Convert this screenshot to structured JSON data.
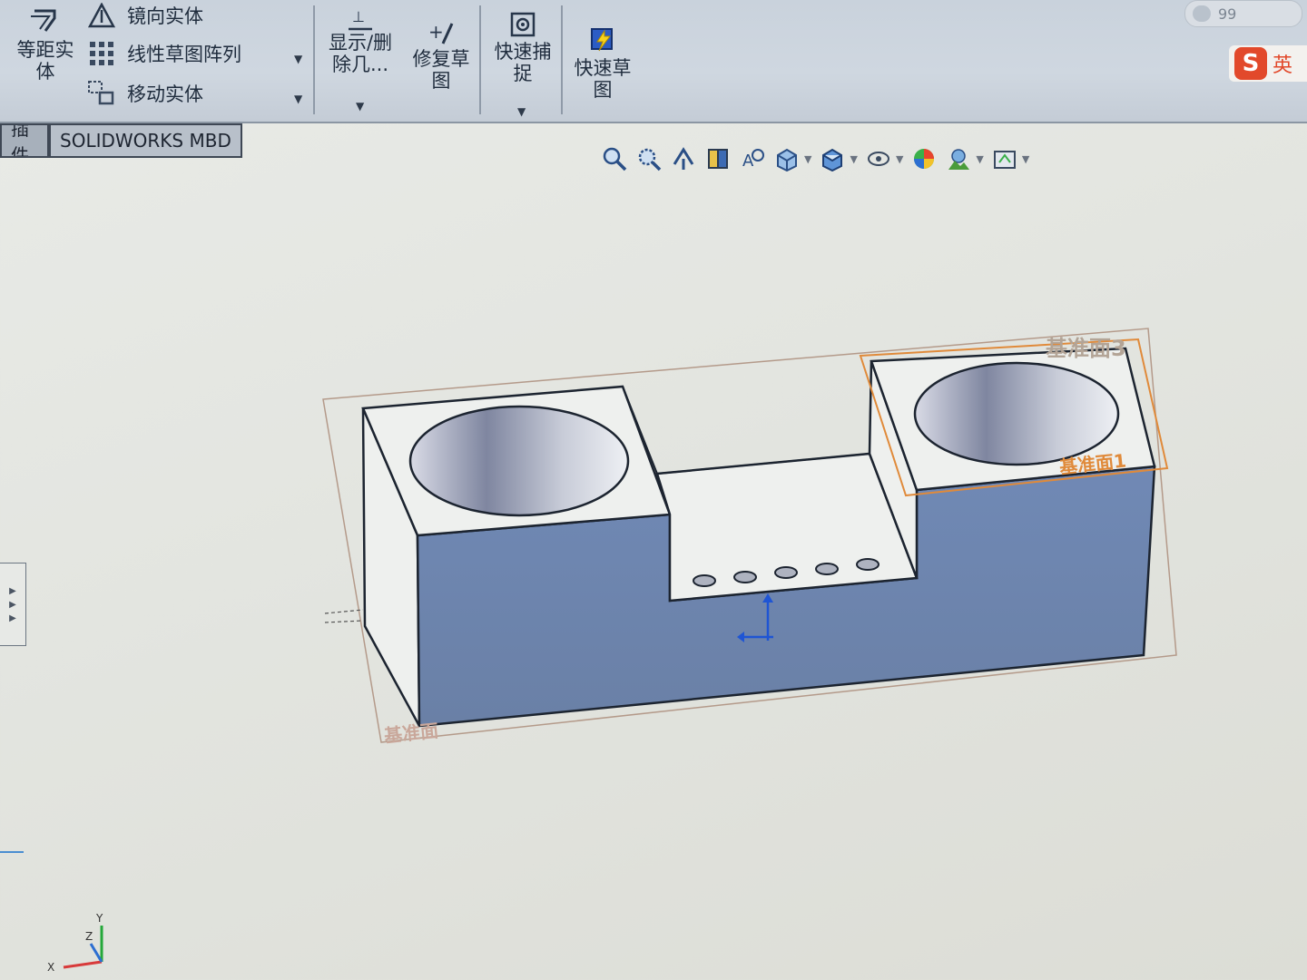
{
  "ribbon": {
    "offset_entities": "等距实\n体",
    "mirror_entities": "镜向实体",
    "linear_pattern": "线性草图阵列",
    "move_entities": "移动实体",
    "show_delete_relations": "显示/删\n除几...",
    "repair_sketch": "修复草\n图",
    "quick_snaps": "快速捕\n捉",
    "rapid_sketch": "快速草\n图"
  },
  "tabs": [
    {
      "label": "插件"
    },
    {
      "label": "SOLIDWORKS MBD"
    }
  ],
  "view_toolbar": {
    "icons": [
      "zoom-to-fit-icon",
      "zoom-to-area-icon",
      "previous-view-icon",
      "section-view-icon",
      "dynamic-annotation-icon",
      "view-orientation-icon",
      "display-style-icon",
      "hide-show-items-icon",
      "edit-appearance-icon",
      "apply-scene-icon",
      "view-settings-icon"
    ]
  },
  "notification": {
    "count": "99"
  },
  "ime": {
    "logo": "S",
    "mode": "英"
  },
  "model": {
    "plane_labels": [
      "基准面3",
      "基准面1",
      "基准面"
    ],
    "hole_count": 5,
    "colors": {
      "front_face": "#6e87b2",
      "top_face": "#eef0ee",
      "edge": "#1c2430",
      "plane_highlight": "#e08a3a"
    }
  },
  "triad": {
    "x": "X",
    "y": "Y",
    "z": "Z"
  }
}
